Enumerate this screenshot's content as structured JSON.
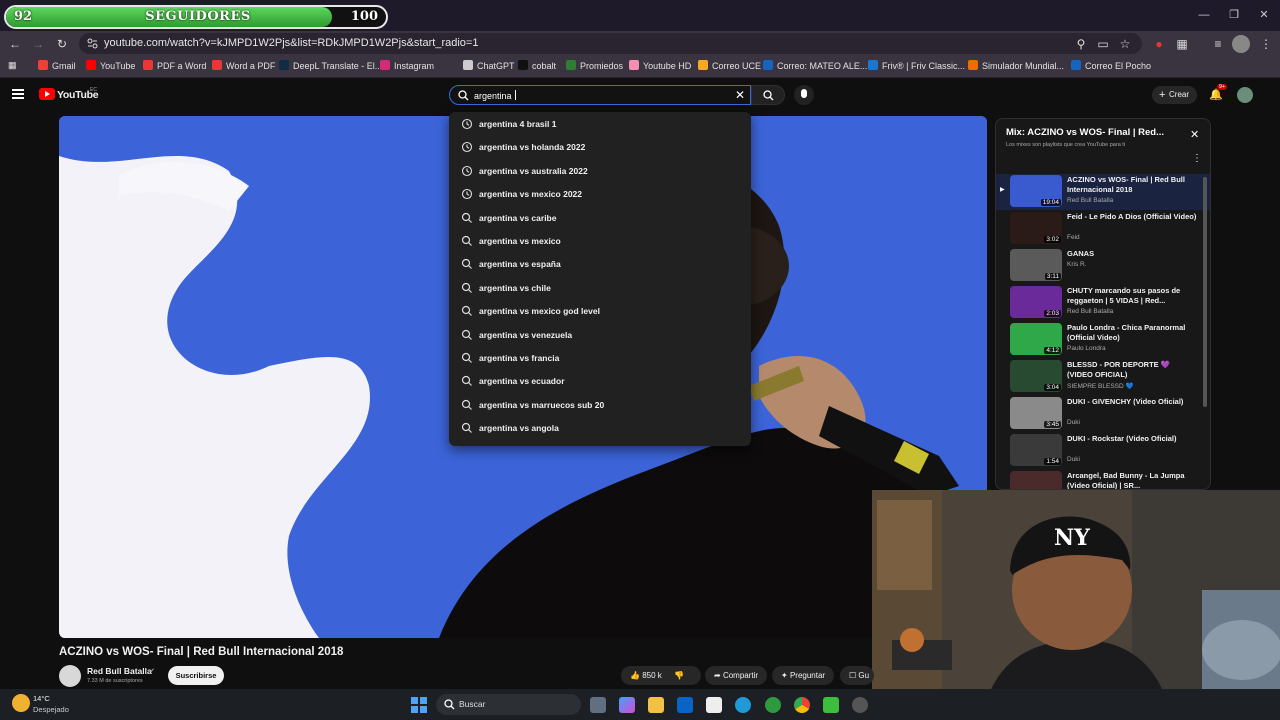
{
  "overlay": {
    "followers_current": "92",
    "followers_label": "SEGUIDORES",
    "followers_goal": "100",
    "progress": 0.92
  },
  "browser": {
    "url": "youtube.com/watch?v=kJMPD1W2Pjs&list=RDkJMPD1W2Pjs&start_radio=1",
    "bookmarks": [
      {
        "label": "Gmail",
        "color": "#ea4335"
      },
      {
        "label": "YouTube",
        "color": "#ff0000"
      },
      {
        "label": "PDF a Word",
        "color": "#e53935"
      },
      {
        "label": "Word a PDF",
        "color": "#e53935"
      },
      {
        "label": "DeepL Translate - El...",
        "color": "#0f2b46"
      },
      {
        "label": "Instagram",
        "color": "#d62976"
      },
      {
        "label": "ChatGPT",
        "color": "#cccccc"
      },
      {
        "label": "cobalt",
        "color": "#111111"
      },
      {
        "label": "Promiedos",
        "color": "#2e7d32"
      },
      {
        "label": "Youtube HD",
        "color": "#f48fb1"
      },
      {
        "label": "Correo UCE",
        "color": "#f9a825"
      },
      {
        "label": "Correo: MATEO ALE...",
        "color": "#1565c0"
      },
      {
        "label": "Friv® | Friv Classic...",
        "color": "#1976d2"
      },
      {
        "label": "Simulador Mundial...",
        "color": "#ef6c00"
      },
      {
        "label": "Correo El Pocho",
        "color": "#1565c0"
      }
    ]
  },
  "youtube": {
    "logo_text": "YouTube",
    "logo_region": "EC",
    "search_value": "argentina ",
    "create_label": "Crear",
    "notif_count": "9+",
    "suggestions": [
      {
        "text": "argentina 4 brasil 1",
        "type": "history"
      },
      {
        "text": "argentina vs holanda 2022",
        "type": "history"
      },
      {
        "text": "argentina vs australia 2022",
        "type": "history"
      },
      {
        "text": "argentina vs mexico 2022",
        "type": "history"
      },
      {
        "text": "argentina vs caribe",
        "type": "search"
      },
      {
        "text": "argentina vs mexico",
        "type": "search"
      },
      {
        "text": "argentina vs españa",
        "type": "search"
      },
      {
        "text": "argentina vs chile",
        "type": "search"
      },
      {
        "text": "argentina vs mexico god level",
        "type": "search"
      },
      {
        "text": "argentina vs venezuela",
        "type": "search"
      },
      {
        "text": "argentina vs francia",
        "type": "search"
      },
      {
        "text": "argentina vs ecuador",
        "type": "search"
      },
      {
        "text": "argentina vs marruecos sub 20",
        "type": "search"
      },
      {
        "text": "argentina vs angola",
        "type": "search"
      }
    ],
    "video_title": "ACZINO vs WOS- Final | Red Bull Internacional 2018",
    "channel_name": "Red Bull Batalla",
    "subscribers": "7.33 M de suscriptores",
    "subscribe_label": "Suscribirse",
    "likes": "850 k",
    "share_label": "Compartir",
    "ask_label": "Preguntar",
    "save_label": "Gu",
    "playlist": {
      "title": "Mix: ACZINO vs WOS- Final | Red...",
      "subtitle": "Los mixes son playlists que crea YouTube para ti",
      "items": [
        {
          "title": "ACZINO vs WOS- Final | Red Bull Internacional 2018",
          "channel": "Red Bull Batalla",
          "duration": "19:04",
          "color": "#3a5bd0"
        },
        {
          "title": "Feid - Le Pido A Dios (Official Video)",
          "channel": "Feid",
          "duration": "3:02",
          "color": "#2a1a18"
        },
        {
          "title": "GANAS",
          "channel": "Kris R.",
          "duration": "3:11",
          "color": "#5a5a5a"
        },
        {
          "title": "CHUTY marcando sus pasos de reggaeton | 5 VIDAS | Red...",
          "channel": "Red Bull Batalla",
          "duration": "2:03",
          "color": "#6b2a9a"
        },
        {
          "title": "Paulo Londra - Chica Paranormal (Official Video)",
          "channel": "Paulo Londra",
          "duration": "4:12",
          "color": "#2fa84a"
        },
        {
          "title": "BLESSD - POR DEPORTE 💜 (VIDEO OFICIAL)",
          "channel": "SIEMPRE BLESSD 💙",
          "duration": "3:04",
          "color": "#284a30"
        },
        {
          "title": "DUKI - GIVENCHY (Video Oficial)",
          "channel": "Duki",
          "duration": "3:45",
          "color": "#8a8a8a"
        },
        {
          "title": "DUKI - Rockstar (Video Oficial)",
          "channel": "Duki",
          "duration": "1:54",
          "color": "#3a3a3a"
        },
        {
          "title": "Arcangel, Bad Bunny - La Jumpa (Video Oficial) | SR...",
          "channel": "",
          "duration": "4:13",
          "color": "#4a2a2a"
        }
      ]
    }
  },
  "taskbar": {
    "temp": "14°C",
    "weather": "Despejado",
    "search_placeholder": "Buscar"
  }
}
